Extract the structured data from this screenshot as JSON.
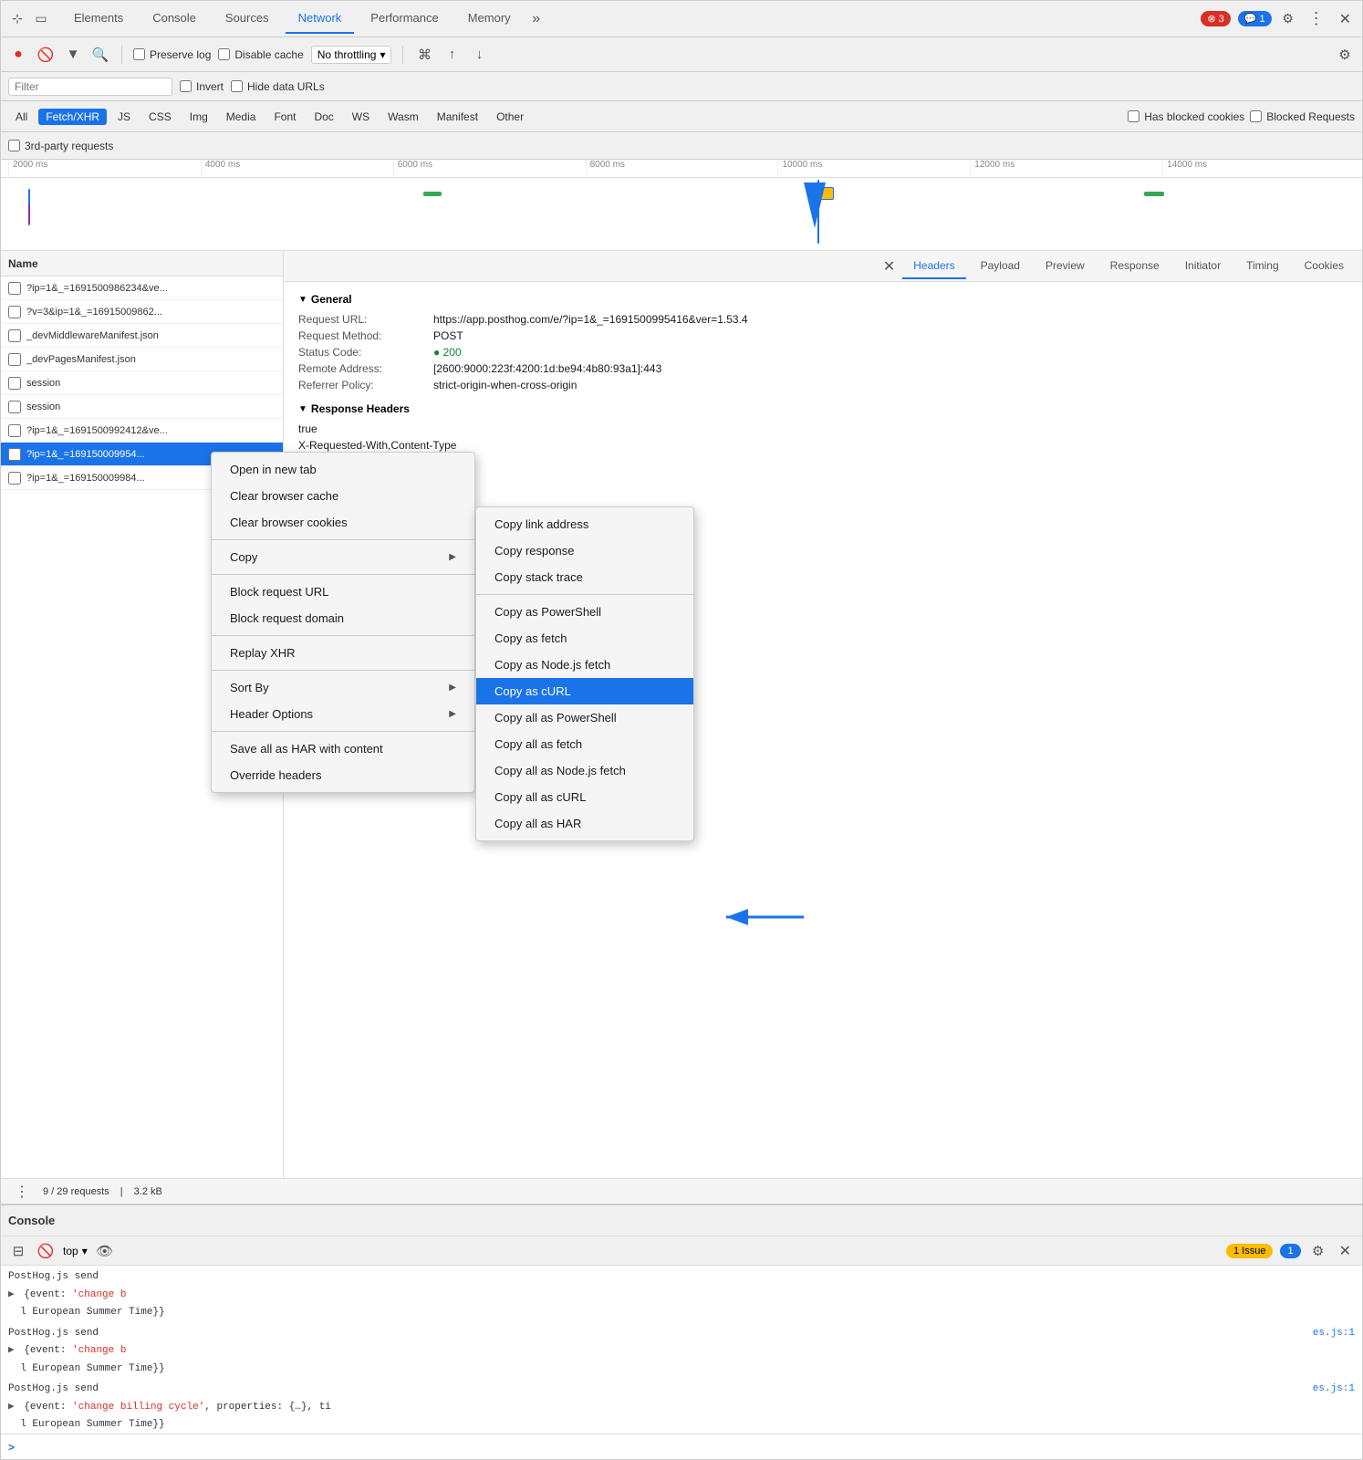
{
  "tabs": {
    "items": [
      {
        "label": "Elements",
        "active": false
      },
      {
        "label": "Console",
        "active": false
      },
      {
        "label": "Sources",
        "active": false
      },
      {
        "label": "Network",
        "active": true
      },
      {
        "label": "Performance",
        "active": false
      },
      {
        "label": "Memory",
        "active": false
      }
    ],
    "more_icon": "≫",
    "error_count": "3",
    "info_count": "1",
    "settings_icon": "⚙",
    "more_vert_icon": "⋮",
    "close_icon": "✕"
  },
  "toolbar": {
    "record_icon": "●",
    "clear_icon": "🚫",
    "filter_icon": "▼",
    "search_icon": "🔍",
    "preserve_log": "Preserve log",
    "disable_cache": "Disable cache",
    "throttle_label": "No throttling",
    "wifi_icon": "wifi",
    "upload_icon": "↑",
    "download_icon": "↓",
    "settings_icon": "⚙"
  },
  "filter": {
    "placeholder": "Filter",
    "invert_label": "Invert",
    "hide_data_urls_label": "Hide data URLs"
  },
  "type_filters": [
    {
      "label": "All",
      "active": false
    },
    {
      "label": "Fetch/XHR",
      "active": true
    },
    {
      "label": "JS",
      "active": false
    },
    {
      "label": "CSS",
      "active": false
    },
    {
      "label": "Img",
      "active": false
    },
    {
      "label": "Media",
      "active": false
    },
    {
      "label": "Font",
      "active": false
    },
    {
      "label": "Doc",
      "active": false
    },
    {
      "label": "WS",
      "active": false
    },
    {
      "label": "Wasm",
      "active": false
    },
    {
      "label": "Manifest",
      "active": false
    },
    {
      "label": "Other",
      "active": false
    }
  ],
  "type_filter_right": {
    "blocked_cookies_label": "Has blocked cookies",
    "blocked_requests_label": "Blocked Requests"
  },
  "third_party": {
    "label": "3rd-party requests"
  },
  "timeline": {
    "marks": [
      "2000 ms",
      "4000 ms",
      "6000 ms",
      "8000 ms",
      "10000 ms",
      "12000 ms",
      "14000 ms"
    ]
  },
  "request_list": {
    "header": "Name",
    "items": [
      {
        "name": "?ip=1&_=1691500986234&ve...",
        "selected": false,
        "red": false
      },
      {
        "name": "?v=3&ip=1&_=16915009862...",
        "selected": false,
        "red": true
      },
      {
        "name": "_devMiddlewareManifest.json",
        "selected": false,
        "red": false
      },
      {
        "name": "_devPagesManifest.json",
        "selected": false,
        "red": false
      },
      {
        "name": "session",
        "selected": false,
        "red": false
      },
      {
        "name": "session",
        "selected": false,
        "red": false
      },
      {
        "name": "?ip=1&_=1691500992412&ve...",
        "selected": false,
        "red": false
      },
      {
        "name": "?ip=1&_=169150009954...",
        "selected": true,
        "red": false
      },
      {
        "name": "?ip=1&_=169150009984...",
        "selected": false,
        "red": false
      }
    ]
  },
  "details": {
    "tabs": [
      "Headers",
      "Payload",
      "Preview",
      "Response",
      "Initiator",
      "Timing",
      "Cookies"
    ],
    "active_tab": "Headers",
    "general_section": "General",
    "request_url_key": "Request URL:",
    "request_url_val": "https://app.posthog.com/e/?ip=1&_=1691500995416&ver=1.53.4",
    "request_method_key": "Request Method:",
    "request_method_val": "POST",
    "status_code_key": "Status Code:",
    "status_code_val": "200",
    "remote_address_key": "Remote Address:",
    "remote_address_val": "[2600:9000:223f:4200:1d:be94:4b80:93a1]:443",
    "referrer_policy_key": "Referrer Policy:",
    "referrer_policy_val": "strict-origin-when-cross-origin",
    "response_headers_section": "Response Headers",
    "response_val1": "true",
    "response_val2": "X-Requested-With,Content-Type"
  },
  "status_bar": {
    "requests": "9 / 29 requests",
    "size": "3.2 kB",
    "separator": "|"
  },
  "context_menu": {
    "items": [
      {
        "label": "Open in new tab",
        "has_submenu": false,
        "separator_after": false
      },
      {
        "label": "Clear browser cache",
        "has_submenu": false,
        "separator_after": false
      },
      {
        "label": "Clear browser cookies",
        "has_submenu": false,
        "separator_after": true
      },
      {
        "label": "Copy",
        "has_submenu": true,
        "separator_after": true
      },
      {
        "label": "Block request URL",
        "has_submenu": false,
        "separator_after": false
      },
      {
        "label": "Block request domain",
        "has_submenu": false,
        "separator_after": true
      },
      {
        "label": "Replay XHR",
        "has_submenu": false,
        "separator_after": true
      },
      {
        "label": "Sort By",
        "has_submenu": true,
        "separator_after": false
      },
      {
        "label": "Header Options",
        "has_submenu": true,
        "separator_after": true
      },
      {
        "label": "Save all as HAR with content",
        "has_submenu": false,
        "separator_after": false
      },
      {
        "label": "Override headers",
        "has_submenu": false,
        "separator_after": false
      }
    ]
  },
  "submenu": {
    "items": [
      {
        "label": "Copy link address",
        "highlighted": false,
        "separator_after": false
      },
      {
        "label": "Copy response",
        "highlighted": false,
        "separator_after": false
      },
      {
        "label": "Copy stack trace",
        "highlighted": false,
        "separator_after": true
      },
      {
        "label": "Copy as PowerShell",
        "highlighted": false,
        "separator_after": false
      },
      {
        "label": "Copy as fetch",
        "highlighted": false,
        "separator_after": false
      },
      {
        "label": "Copy as Node.js fetch",
        "highlighted": false,
        "separator_after": false
      },
      {
        "label": "Copy as cURL",
        "highlighted": true,
        "separator_after": false
      },
      {
        "label": "Copy all as PowerShell",
        "highlighted": false,
        "separator_after": false
      },
      {
        "label": "Copy all as fetch",
        "highlighted": false,
        "separator_after": false
      },
      {
        "label": "Copy all as Node.js fetch",
        "highlighted": false,
        "separator_after": false
      },
      {
        "label": "Copy all as cURL",
        "highlighted": false,
        "separator_after": false
      },
      {
        "label": "Copy all as HAR",
        "highlighted": false,
        "separator_after": false
      }
    ]
  },
  "console": {
    "title": "Console",
    "toolbar": {
      "sidebar_icon": "⊟",
      "clear_icon": "🚫",
      "level_label": "top",
      "eye_icon": "👁",
      "issues_count": "1 Issue",
      "settings_icon": "⚙",
      "close_icon": "✕"
    },
    "lines": [
      {
        "text": "PostHog.js send",
        "prefix": "",
        "link": ""
      },
      {
        "text": "{event: 'change b",
        "prefix": "▶",
        "red": true,
        "link": ""
      },
      {
        "text": "l European Summer Time}}",
        "prefix": "",
        "link": ""
      },
      {
        "spacer": true
      },
      {
        "text": "PostHog.js send",
        "prefix": "",
        "link": "es.js:1"
      },
      {
        "text": "{event: 'change b",
        "prefix": "▶",
        "red": true,
        "link": ""
      },
      {
        "text": "l European Summer Time}}",
        "prefix": "",
        "link": ""
      },
      {
        "spacer": true
      },
      {
        "text": "PostHog.js send",
        "prefix": "",
        "link": "es.js:1"
      },
      {
        "text": "{event: 'change billing cycle', properties: {…}, ti",
        "prefix": "▶",
        "red": true,
        "link": ""
      },
      {
        "text": "l European Summer Time}}",
        "prefix": "",
        "link": ""
      }
    ]
  }
}
